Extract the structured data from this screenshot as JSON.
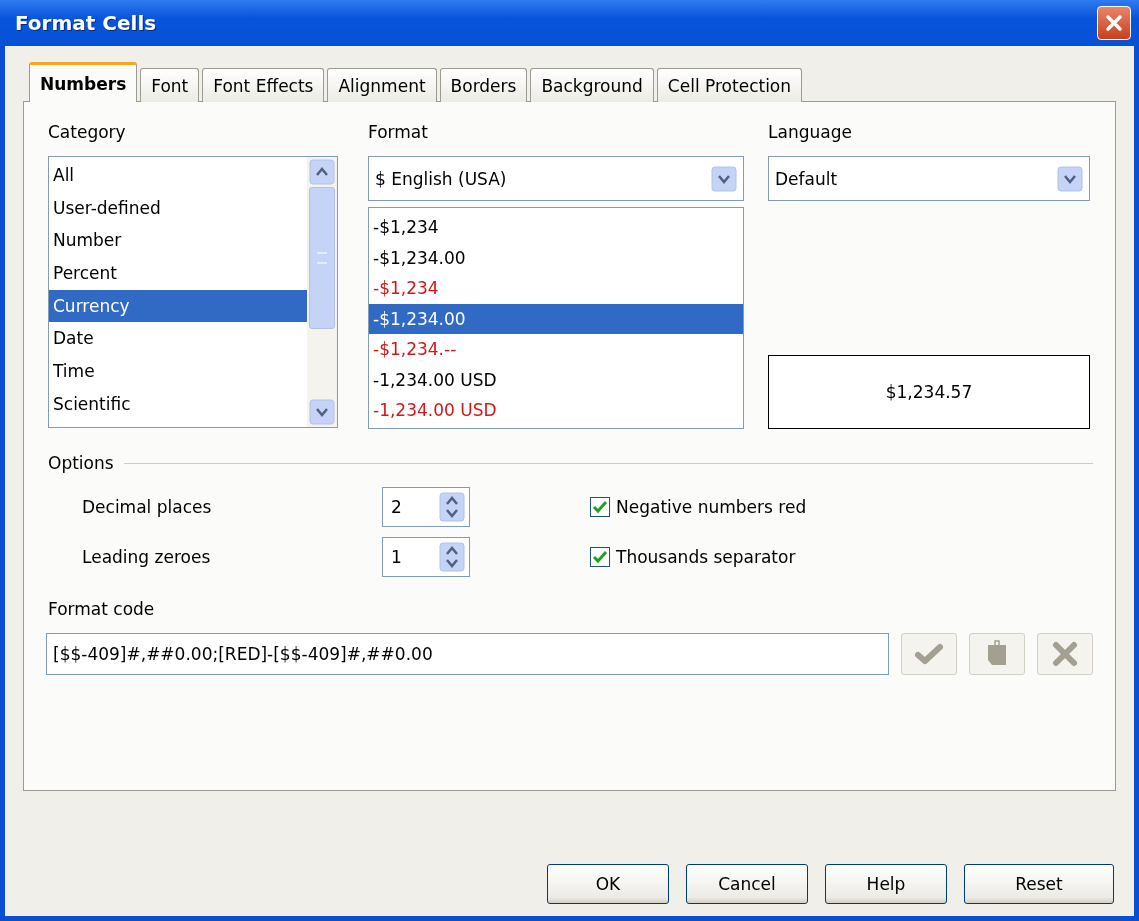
{
  "window": {
    "title": "Format Cells"
  },
  "tabs": [
    {
      "label": "Numbers",
      "selected": true
    },
    {
      "label": "Font",
      "selected": false
    },
    {
      "label": "Font Effects",
      "selected": false
    },
    {
      "label": "Alignment",
      "selected": false
    },
    {
      "label": "Borders",
      "selected": false
    },
    {
      "label": "Background",
      "selected": false
    },
    {
      "label": "Cell Protection",
      "selected": false
    }
  ],
  "category": {
    "label": "Category",
    "items": [
      {
        "label": "All",
        "selected": false
      },
      {
        "label": "User-defined",
        "selected": false
      },
      {
        "label": "Number",
        "selected": false
      },
      {
        "label": "Percent",
        "selected": false
      },
      {
        "label": "Currency",
        "selected": true
      },
      {
        "label": "Date",
        "selected": false
      },
      {
        "label": "Time",
        "selected": false
      },
      {
        "label": "Scientific",
        "selected": false
      }
    ]
  },
  "format": {
    "label": "Format",
    "combo_value": "$ English (USA)",
    "items": [
      {
        "label": "-$1,234",
        "red": false,
        "selected": false
      },
      {
        "label": "-$1,234.00",
        "red": false,
        "selected": false
      },
      {
        "label": "-$1,234",
        "red": true,
        "selected": false
      },
      {
        "label": "-$1,234.00",
        "red": true,
        "selected": true
      },
      {
        "label": "-$1,234.--",
        "red": true,
        "selected": false
      },
      {
        "label": "-1,234.00 USD",
        "red": false,
        "selected": false
      },
      {
        "label": "-1,234.00 USD",
        "red": true,
        "selected": false
      }
    ]
  },
  "language": {
    "label": "Language",
    "value": "Default"
  },
  "preview": "$1,234.57",
  "options": {
    "title": "Options",
    "spinners": [
      {
        "label": "Decimal places",
        "value": "2"
      },
      {
        "label": "Leading zeroes",
        "value": "1"
      }
    ],
    "checkboxes": [
      {
        "label": "Negative numbers red",
        "checked": true
      },
      {
        "label": "Thousands separator",
        "checked": true
      }
    ]
  },
  "format_code": {
    "label": "Format code",
    "value": "[$$-409]#,##0.00;[RED]-[$$-409]#,##0.00"
  },
  "buttons": [
    "OK",
    "Cancel",
    "Help",
    "Reset"
  ]
}
